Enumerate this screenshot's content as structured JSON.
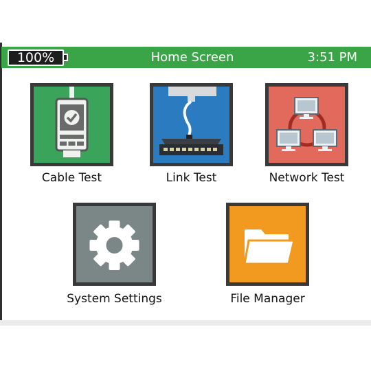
{
  "status_bar": {
    "battery": "100%",
    "title": "Home Screen",
    "time": "3:51 PM"
  },
  "tiles": [
    {
      "label": "Cable Test",
      "icon": "cable-tester-icon",
      "color": "#3aa55a"
    },
    {
      "label": "Link Test",
      "icon": "network-switch-icon",
      "color": "#2a7bbf"
    },
    {
      "label": "Network Test",
      "icon": "network-computers-icon",
      "color": "#e26a5c"
    },
    {
      "label": "System Settings",
      "icon": "gear-icon",
      "color": "#7b8686"
    },
    {
      "label": "File Manager",
      "icon": "folder-icon",
      "color": "#f29a1f"
    }
  ],
  "colors": {
    "status_bar": "#3aa547",
    "battery_fill": "#1d1d1d",
    "tile_border": "#393939"
  }
}
